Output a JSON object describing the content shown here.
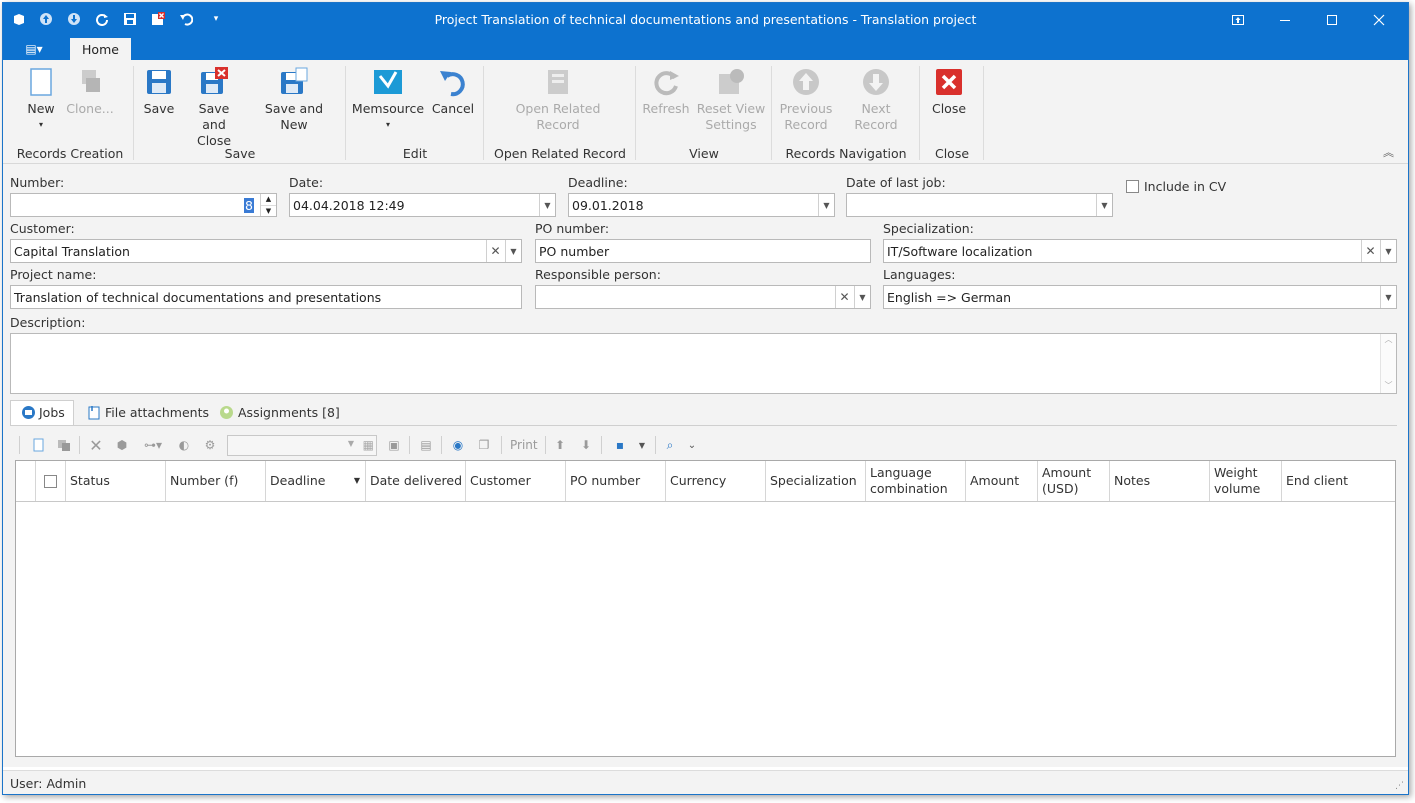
{
  "window": {
    "title": "Project Translation of technical documentations and presentations - Translation project",
    "controls": [
      "restore-down",
      "minimize",
      "maximize",
      "close"
    ]
  },
  "app_menu_label": "▤▾",
  "ribbon": {
    "tab": "Home",
    "groups": {
      "records_creation": "Records Creation",
      "save": "Save",
      "edit": "Edit",
      "open_related": "Open Related Record",
      "view": "View",
      "navigation": "Records Navigation",
      "close": "Close"
    },
    "buttons": {
      "new": "New",
      "clone": "Clone...",
      "save": "Save",
      "save_and_close_1": "Save and",
      "save_and_close_2": "Close",
      "save_and_new": "Save and New",
      "memsource": "Memsource",
      "cancel": "Cancel",
      "open_related_1": "Open Related",
      "open_related_2": "Record",
      "refresh": "Refresh",
      "reset_view_1": "Reset View",
      "reset_view_2": "Settings",
      "previous_1": "Previous",
      "previous_2": "Record",
      "next": "Next Record",
      "close": "Close"
    }
  },
  "form": {
    "number_label": "Number:",
    "number_value": "8",
    "date_label": "Date:",
    "date_value": "04.04.2018 12:49",
    "deadline_label": "Deadline:",
    "deadline_value": "09.01.2018",
    "last_job_label": "Date of last job:",
    "last_job_value": "",
    "include_cv_label": "Include in CV",
    "customer_label": "Customer:",
    "customer_value": "Capital Translation",
    "po_label": "PO number:",
    "po_value": "PO number",
    "spec_label": "Specialization:",
    "spec_value": "IT/Software localization",
    "project_label": "Project name:",
    "project_value": "Translation of technical documentations and presentations",
    "resp_label": "Responsible person:",
    "resp_value": "",
    "lang_label": "Languages:",
    "lang_value": "English => German",
    "desc_label": "Description:",
    "desc_value": ""
  },
  "tabs": {
    "jobs": "Jobs",
    "files": "File attachments",
    "assignments": "Assignments [8]"
  },
  "toolbar": {
    "print": "Print"
  },
  "grid": {
    "columns": [
      {
        "label": "Status"
      },
      {
        "label": "Number (f)"
      },
      {
        "label": "Deadline"
      },
      {
        "label": "Date delivered"
      },
      {
        "label": "Customer"
      },
      {
        "label": "PO number"
      },
      {
        "label": "Currency"
      },
      {
        "label": "Specialization"
      },
      {
        "label": "Language combination"
      },
      {
        "label": "Amount"
      },
      {
        "label": "Amount (USD)"
      },
      {
        "label": "Notes"
      },
      {
        "label": "Weight volume"
      },
      {
        "label": "End client"
      }
    ]
  },
  "status_bar": "User: Admin",
  "colors": {
    "accent": "#0d72cf",
    "danger": "#d9302c"
  }
}
